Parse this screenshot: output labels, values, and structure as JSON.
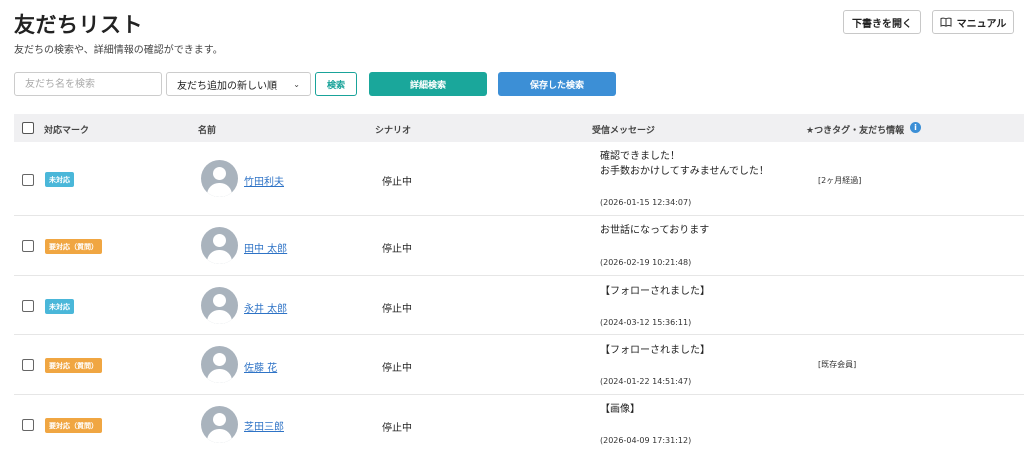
{
  "header": {
    "title": "友だちリスト",
    "subtitle": "友だちの検索や、詳細情報の確認ができます。",
    "draft_button": "下書きを開く",
    "manual_button": "マニュアル"
  },
  "toolbar": {
    "search_placeholder": "友だち名を検索",
    "sort_value": "友だち追加の新しい順",
    "search_button": "検索",
    "detail_search_button": "詳細検索",
    "saved_search_button": "保存した検索"
  },
  "colors": {
    "teal": "#1aa79b",
    "blue": "#3c8fd6",
    "badge_unhandled": "#4ab7d9",
    "badge_needs_action": "#f0a642",
    "link": "#2e73c6"
  },
  "table": {
    "columns": [
      "対応マーク",
      "名前",
      "シナリオ",
      "受信メッセージ",
      "★つきタグ・友だち情報"
    ],
    "rows": [
      {
        "status": "未対応",
        "status_color": "blue",
        "name": "竹田利夫",
        "scenario": "停止中",
        "message_line1": "確認できました！",
        "message_line2": "お手数おかけしてすみませんでした！",
        "timestamp": "(2026-01-15 12:34:07)",
        "tag": "[2ヶ月経過]"
      },
      {
        "status": "要対応（質問）",
        "status_color": "orange",
        "name": "田中 太郎",
        "scenario": "停止中",
        "message_line1": "お世話になっております",
        "message_line2": "",
        "timestamp": "(2026-02-19 10:21:48)",
        "tag": ""
      },
      {
        "status": "未対応",
        "status_color": "blue",
        "name": "永井 太郎",
        "scenario": "停止中",
        "message_line1": "【フォローされました】",
        "message_line2": "",
        "timestamp": "(2024-03-12 15:36:11)",
        "tag": ""
      },
      {
        "status": "要対応（質問）",
        "status_color": "orange",
        "name": "佐藤 花",
        "scenario": "停止中",
        "message_line1": "【フォローされました】",
        "message_line2": "",
        "timestamp": "(2024-01-22 14:51:47)",
        "tag": "[既存会員]"
      },
      {
        "status": "要対応（質問）",
        "status_color": "orange",
        "name": "芝田三郎",
        "scenario": "停止中",
        "message_line1": "【画像】",
        "message_line2": "",
        "timestamp": "(2026-04-09 17:31:12)",
        "tag": ""
      }
    ]
  }
}
